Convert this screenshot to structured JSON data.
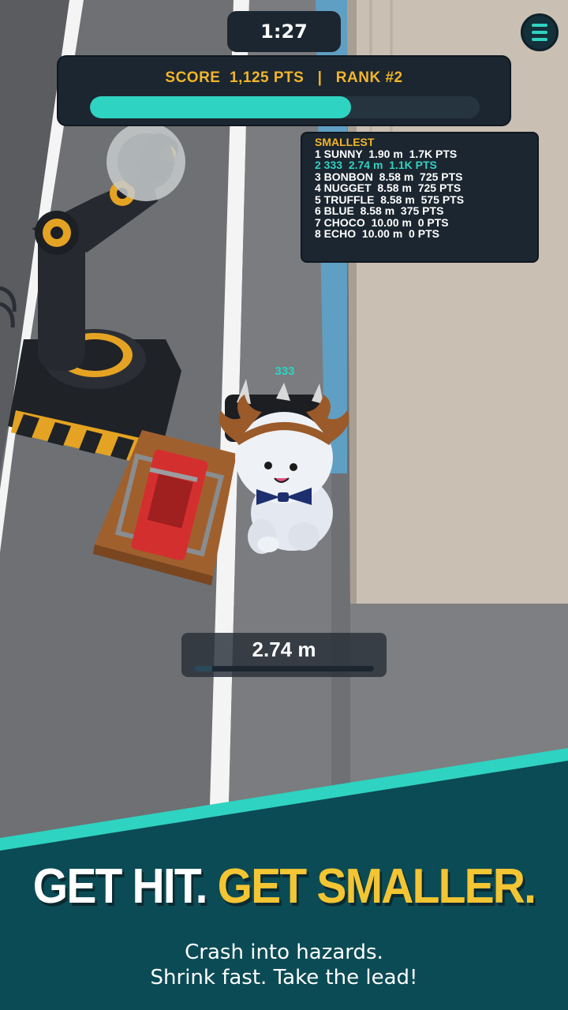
{
  "hud": {
    "timer": "1:27",
    "score_line": "SCORE  1,125 PTS   |   RANK #2",
    "score_progress": 0.67
  },
  "leaderboard": {
    "title": "SMALLEST",
    "rows": [
      "1 SUNNY  1.90 m  1.7K PTS",
      "2 333  2.74 m  1.1K PTS",
      "3 BONBON  8.58 m  725 PTS",
      "4 NUGGET  8.58 m  725 PTS",
      "5 TRUFFLE  8.58 m  575 PTS",
      "6 BLUE  8.58 m  375 PTS",
      "7 CHOCO  10.00 m  0 PTS",
      "8 ECHO  10.00 m  0 PTS"
    ],
    "highlight_row": 1
  },
  "player": {
    "name": "333"
  },
  "size_meter": {
    "value": "2.74 m",
    "progress": 0.1
  },
  "promo": {
    "headline_white": "GET HIT.",
    "headline_yellow": "GET SMALLER.",
    "line1": "Crash into hazards.",
    "line2": "Shrink fast. Take the lead!"
  },
  "colors": {
    "accent": "#2fd3c1",
    "gold": "#f3b52a",
    "banner": "#0b4b55",
    "panel": "#1b2630"
  },
  "icons": [
    "menu-icon"
  ]
}
